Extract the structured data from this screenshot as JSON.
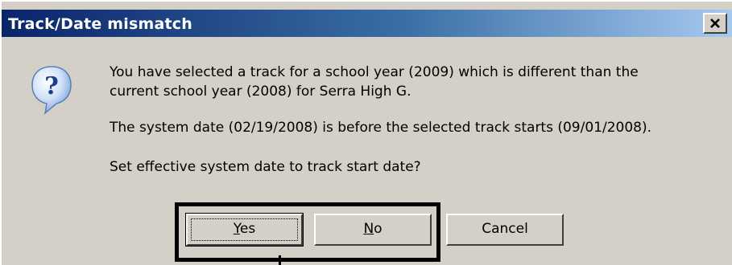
{
  "window": {
    "title": "Track/Date mismatch",
    "close_glyph": "✕"
  },
  "icon": {
    "name": "question-icon",
    "glyph": "?"
  },
  "message": {
    "line1": "You have selected a track for a school year (2009) which is different than the",
    "line2": "current school year (2008) for Serra High G.",
    "line3": "The system date (02/19/2008) is before the selected track starts (09/01/2008).",
    "line4": "Set effective system date to track start date?"
  },
  "buttons": {
    "yes": {
      "mnemonic": "Y",
      "rest": "es"
    },
    "no": {
      "mnemonic": "N",
      "rest": "o"
    },
    "cancel": {
      "label": "Cancel"
    }
  },
  "colors": {
    "title_start": "#0a246a",
    "title_end": "#a6caf0",
    "face": "#d4d0c8"
  }
}
